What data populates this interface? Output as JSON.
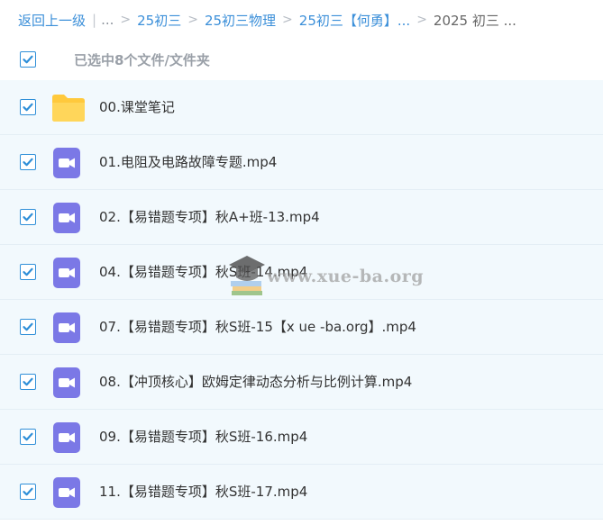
{
  "breadcrumb": {
    "back": "返回上一级",
    "ellipsis": "...",
    "items": [
      "25初三",
      "25初三物理",
      "25初三【何勇】...",
      "2025 初三 ..."
    ]
  },
  "selection": {
    "checked": true,
    "label": "已选中8个文件/文件夹"
  },
  "files": [
    {
      "name": "00.课堂笔记",
      "type": "folder",
      "checked": true
    },
    {
      "name": "01.电阻及电路故障专题.mp4",
      "type": "video",
      "checked": true
    },
    {
      "name": "02.【易错题专项】秋A+班-13.mp4",
      "type": "video",
      "checked": true
    },
    {
      "name": "04.【易错题专项】秋S班-14.mp4",
      "type": "video",
      "checked": true
    },
    {
      "name": "07.【易错题专项】秋S班-15【x ue -ba.org】.mp4",
      "type": "video",
      "checked": true
    },
    {
      "name": "08.【冲顶核心】欧姆定律动态分析与比例计算.mp4",
      "type": "video",
      "checked": true
    },
    {
      "name": "09.【易错题专项】秋S班-16.mp4",
      "type": "video",
      "checked": true
    },
    {
      "name": "11.【易错题专项】秋S班-17.mp4",
      "type": "video",
      "checked": true
    }
  ],
  "watermark": {
    "text": "www.xue-ba.org"
  },
  "colors": {
    "accent": "#2f8fd8",
    "row_bg": "#f2f9fd",
    "video_icon": "#7b78e6",
    "folder_icon": "#ffc93c"
  }
}
